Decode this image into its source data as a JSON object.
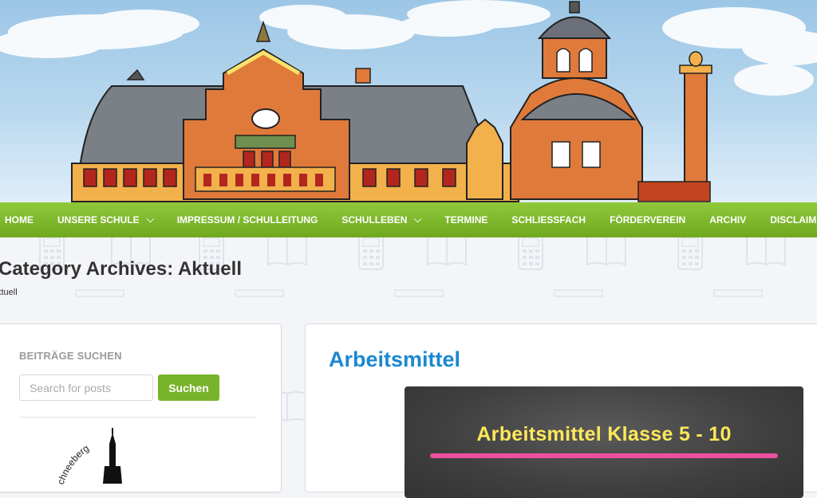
{
  "nav": {
    "items": [
      {
        "label": "Home",
        "dropdown": false
      },
      {
        "label": "Unsere Schule",
        "dropdown": true
      },
      {
        "label": "Impressum / Schulleitung",
        "dropdown": false
      },
      {
        "label": "Schulleben",
        "dropdown": true
      },
      {
        "label": "Termine",
        "dropdown": false
      },
      {
        "label": "Schliessfach",
        "dropdown": false
      },
      {
        "label": "Förderverein",
        "dropdown": false
      },
      {
        "label": "Archiv",
        "dropdown": false
      },
      {
        "label": "Disclaimer",
        "dropdown": false
      }
    ]
  },
  "page": {
    "title": "Category Archives: Aktuell",
    "breadcrumb": "ktuell"
  },
  "sidebar": {
    "widget_title": "BEITRÄGE SUCHEN",
    "search_placeholder": "Search for posts",
    "search_button": "Suchen",
    "logo_text": "chneeberg"
  },
  "post": {
    "title": "Arbeitsmittel",
    "image_text": "Arbeitsmittel Klasse 5 - 10"
  },
  "colors": {
    "nav_green": "#7cb82f",
    "link_blue": "#1a88cf",
    "button_green": "#77b32b",
    "chalk_yellow": "#ffe85a",
    "chalk_pink": "#ee4fa0"
  }
}
